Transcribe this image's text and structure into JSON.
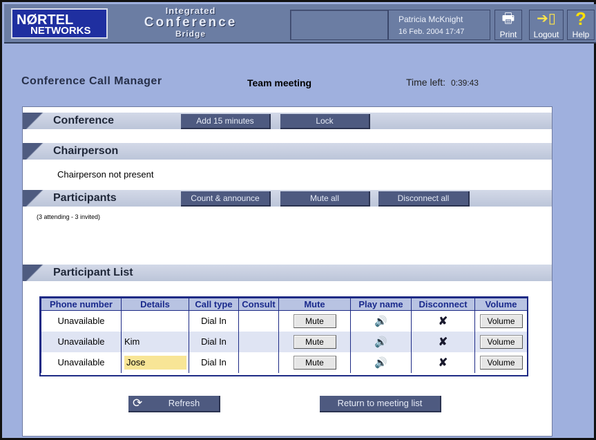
{
  "header": {
    "logo_line1": "NØRTEL",
    "logo_line2": "NETWORKS",
    "product_line1": "Integrated",
    "product_line2": "Conference",
    "product_line3": "Bridge",
    "user_name": "Patricia McKnight",
    "datetime": "16 Feb. 2004 17:47",
    "print_label": "Print",
    "logout_label": "Logout",
    "help_label": "Help"
  },
  "title_row": {
    "page_title": "Conference Call Manager",
    "meeting_name": "Team meeting",
    "time_left_label": "Time left:",
    "time_left_value": "0:39:43"
  },
  "conference": {
    "title": "Conference",
    "add_button": "Add 15 minutes",
    "lock_button": "Lock"
  },
  "chairperson": {
    "title": "Chairperson",
    "status": "Chairperson not present"
  },
  "participants": {
    "title": "Participants",
    "count_button": "Count & announce",
    "mute_all_button": "Mute all",
    "disconnect_all_button": "Disconnect all",
    "summary": "(3 attending - 3 invited)"
  },
  "participant_list": {
    "title": "Participant List",
    "columns": [
      "Phone number",
      "Details",
      "Call type",
      "Consult",
      "Mute",
      "Play name",
      "Disconnect",
      "Volume"
    ],
    "rows": [
      {
        "phone": "Unavailable",
        "details": "",
        "call_type": "Dial In",
        "consult": "",
        "mute": "Mute",
        "volume": "Volume"
      },
      {
        "phone": "Unavailable",
        "details": "Kim",
        "call_type": "Dial In",
        "consult": "",
        "mute": "Mute",
        "volume": "Volume"
      },
      {
        "phone": "Unavailable",
        "details": "Jose",
        "call_type": "Dial In",
        "consult": "",
        "mute": "Mute",
        "volume": "Volume"
      }
    ]
  },
  "footer": {
    "refresh_button": "Refresh",
    "return_button": "Return to meeting list"
  },
  "colors": {
    "page_background": "#9fb0de",
    "header_background": "#6b7da3",
    "button_background": "#4e5a80",
    "table_border": "#1d2a85",
    "highlight": "#f8e596"
  }
}
